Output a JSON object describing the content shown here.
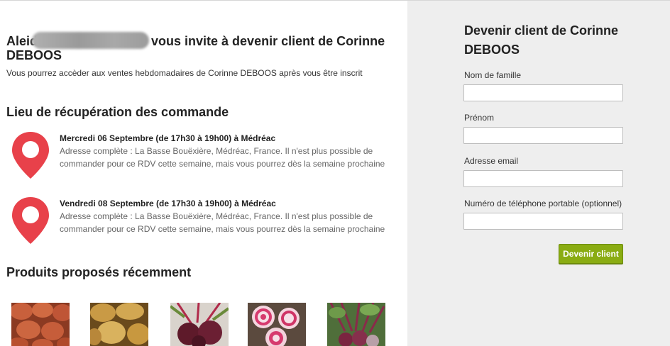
{
  "invite": {
    "name_start": "Aleid",
    "text": "vous invite à devenir client de Corinne DEBOOS",
    "subtitle": "Vous pourrez accèder aux ventes hebdomadaires de Corinne DEBOOS après vous être inscrit"
  },
  "pickup": {
    "title": "Lieu de récupération des commande",
    "items": [
      {
        "title": "Mercredi 06 Septembre (de 17h30 à 19h00) à Médréac",
        "description": "Adresse complète : La Basse Bouëxière, Médréac, France. Il n'est plus possible de commander pour ce RDV cette semaine, mais vous pourrez dès la semaine prochaine",
        "icon": "map-pin-icon"
      },
      {
        "title": "Vendredi 08 Septembre (de 17h30 à 19h00) à Médréac",
        "description": "Adresse complète : La Basse Bouëxière, Médréac, France. Il n'est plus possible de commander pour ce RDV cette semaine, mais vous pourrez dès la semaine prochaine",
        "icon": "map-pin-icon"
      }
    ]
  },
  "products": {
    "title": "Produits proposés récemment",
    "images": [
      "red-potatoes",
      "yellow-potatoes",
      "beetroots",
      "chioggia-beets",
      "bunched-beets"
    ]
  },
  "form": {
    "title": "Devenir client de Corinne DEBOOS",
    "lastname_label": "Nom de famille",
    "firstname_label": "Prénom",
    "email_label": "Adresse email",
    "phone_label": "Numéro de téléphone portable (optionnel)",
    "lastname_value": "",
    "firstname_value": "",
    "email_value": "",
    "phone_value": "",
    "submit_label": "Devenir client"
  },
  "colors": {
    "accent": "#8aac12",
    "pin": "#e8414a",
    "sidebar_bg": "#eeeeee"
  }
}
